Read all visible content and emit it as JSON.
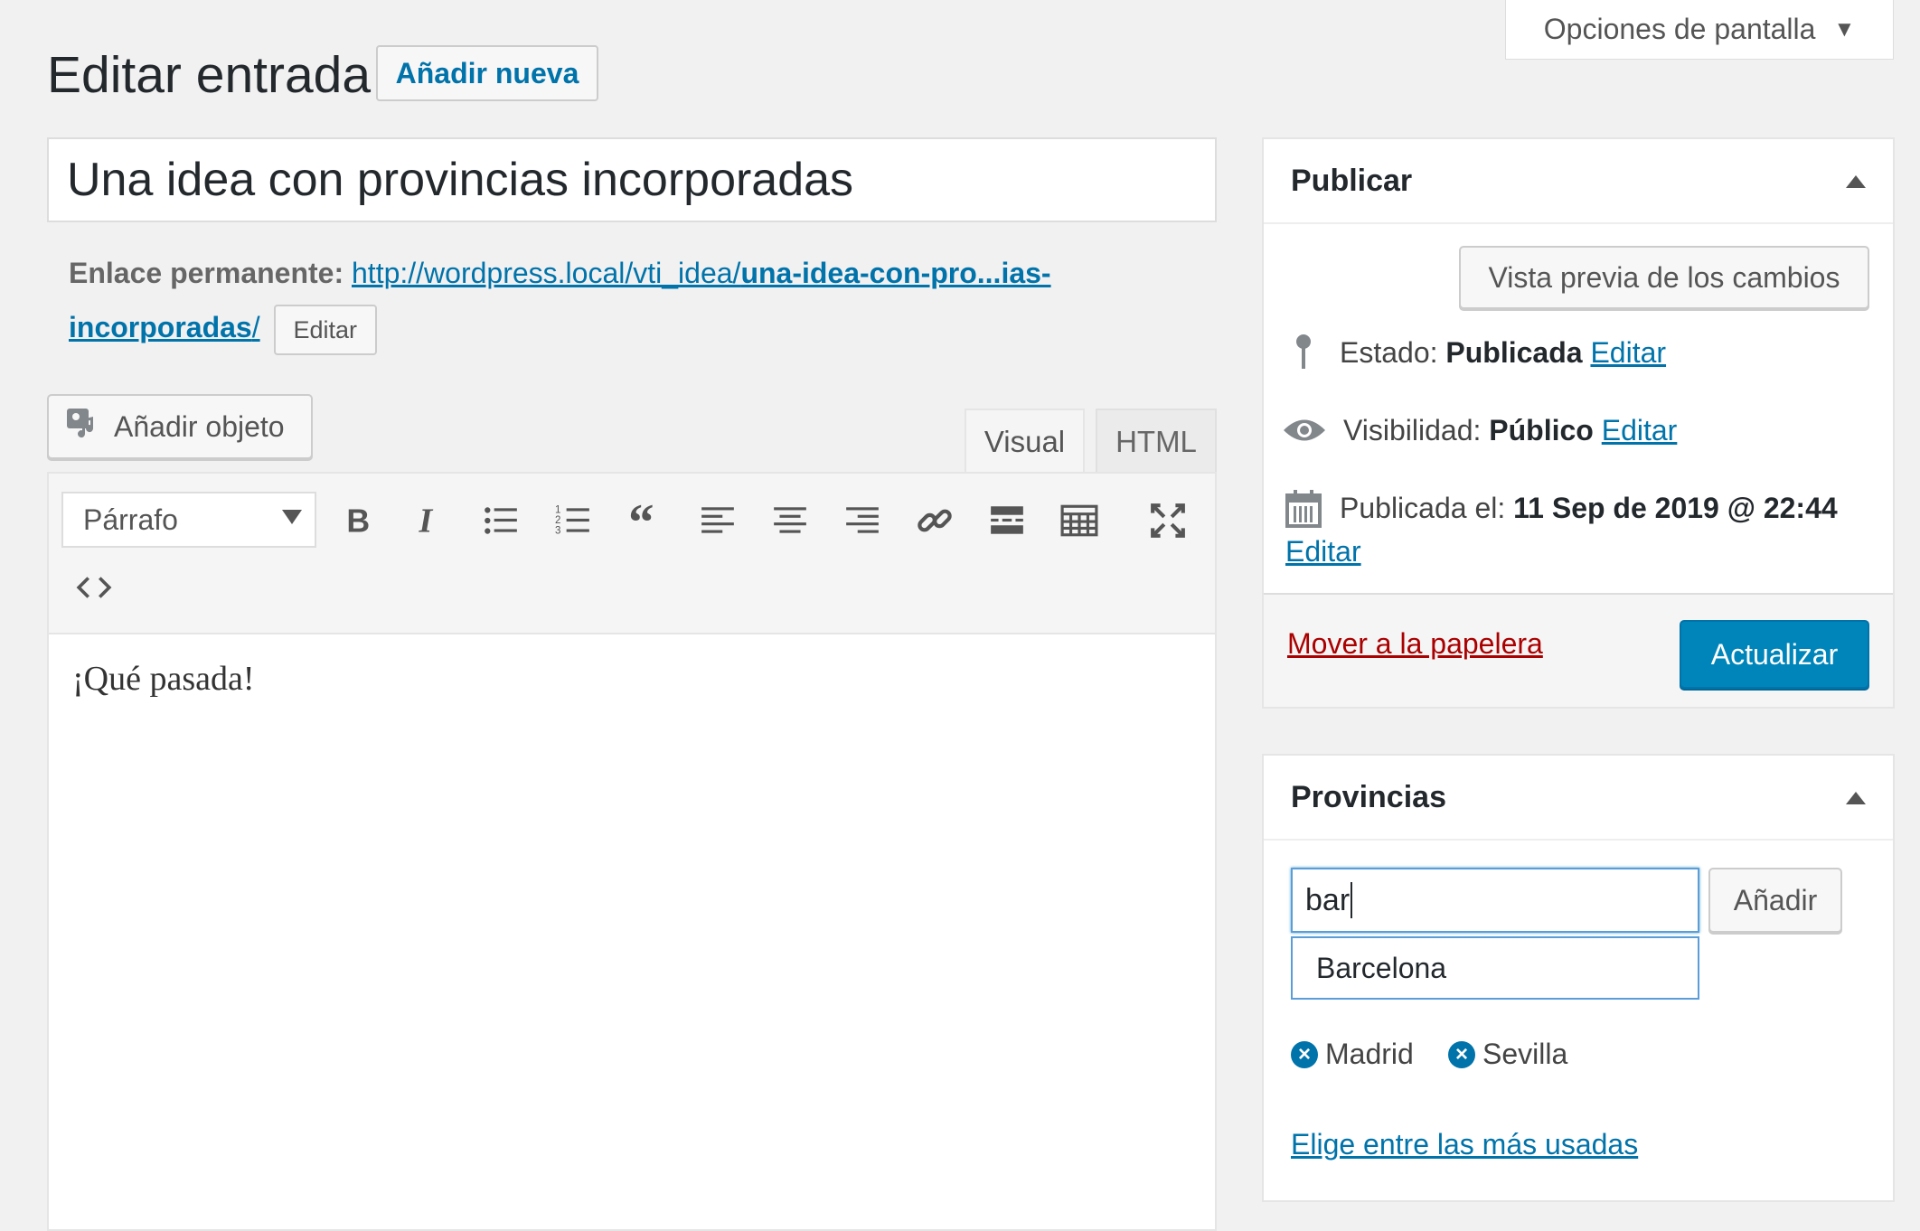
{
  "screen_options": {
    "label": "Opciones de pantalla"
  },
  "header": {
    "title": "Editar entrada",
    "add_new": "Añadir nueva"
  },
  "post": {
    "title": "Una idea con provincias incorporadas",
    "permalink_label": "Enlace permanente:",
    "permalink_base": "http://wordpress.local/vti_idea/",
    "permalink_slug_1": "una-idea-con-pro...ias-",
    "permalink_slug_2": "incorporadas",
    "permalink_trailing": "/",
    "permalink_edit": "Editar",
    "content": "¡Qué pasada!"
  },
  "editor": {
    "add_media": "Añadir objeto",
    "tab_visual": "Visual",
    "tab_html": "HTML",
    "format_select": "Párrafo"
  },
  "publish": {
    "title": "Publicar",
    "preview": "Vista previa de los cambios",
    "status_label": "Estado:",
    "status_value": "Publicada",
    "visibility_label": "Visibilidad:",
    "visibility_value": "Público",
    "published_label": "Publicada el:",
    "published_value": "11 Sep de 2019 @ 22:44",
    "edit": "Editar",
    "trash": "Mover a la papelera",
    "update": "Actualizar"
  },
  "provincias": {
    "title": "Provincias",
    "input_value": "bar",
    "add_button": "Añadir",
    "suggestion": "Barcelona",
    "tags": [
      "Madrid",
      "Sevilla"
    ],
    "most_used": "Elige entre las más usadas"
  },
  "colors": {
    "link": "#0073aa",
    "primary_button": "#0085ba",
    "trash": "#a00"
  }
}
